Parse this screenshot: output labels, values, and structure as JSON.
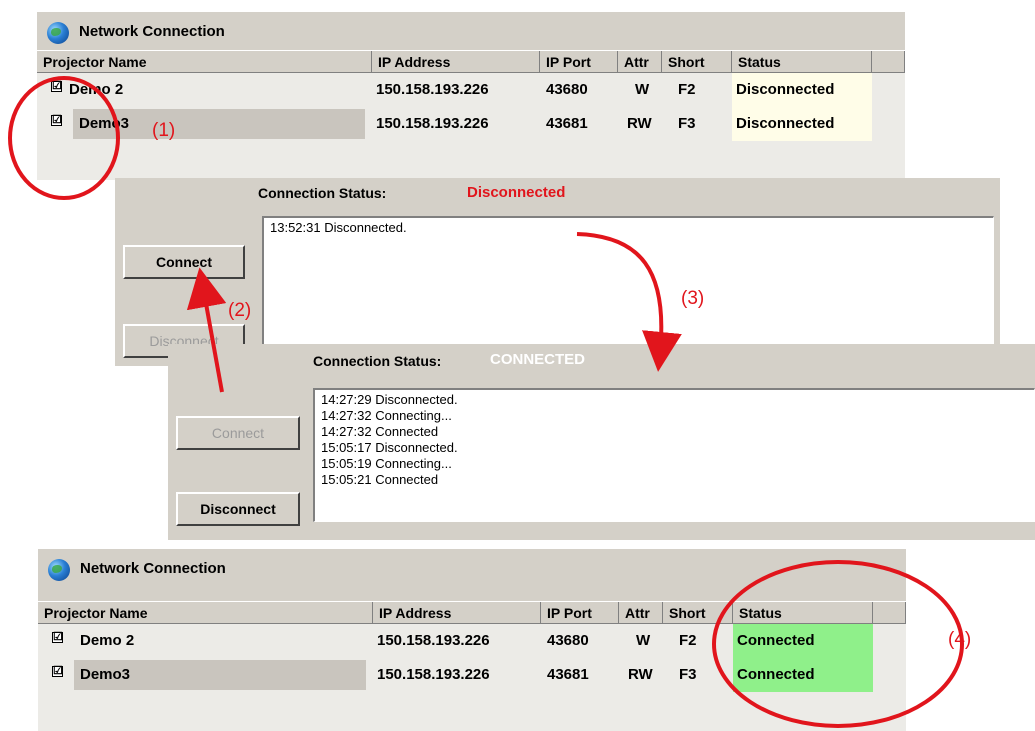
{
  "top_window": {
    "title": "Network Connection",
    "columns": [
      "Projector Name",
      "IP Address",
      "IP Port",
      "Attr",
      "Short",
      "Status"
    ],
    "rows": [
      {
        "checked": "☑",
        "name": "Demo 2",
        "ip": "150.158.193.226",
        "port": "43680",
        "attr": "W",
        "short": "F2",
        "status": "Disconnected"
      },
      {
        "checked": "☑",
        "name": "Demo3",
        "ip": "150.158.193.226",
        "port": "43681",
        "attr": "RW",
        "short": "F3",
        "status": "Disconnected"
      }
    ]
  },
  "panel_disconnected": {
    "status_label": "Connection Status:",
    "status_value": "Disconnected",
    "status_color": "#e1151c",
    "connect_label": "Connect",
    "disconnect_label": "Disconnect",
    "log": [
      "13:52:31 Disconnected."
    ]
  },
  "panel_connected": {
    "status_label": "Connection Status:",
    "status_value": "CONNECTED",
    "status_color": "#ffffff",
    "connect_label": "Connect",
    "disconnect_label": "Disconnect",
    "log": [
      "14:27:29 Disconnected.",
      "14:27:32 Connecting...",
      "14:27:32 Connected",
      "15:05:17 Disconnected.",
      "15:05:19 Connecting...",
      "15:05:21 Connected"
    ]
  },
  "bottom_window": {
    "title": "Network Connection",
    "columns": [
      "Projector Name",
      "IP Address",
      "IP Port",
      "Attr",
      "Short",
      "Status"
    ],
    "rows": [
      {
        "checked": "☑",
        "name": "Demo 2",
        "ip": "150.158.193.226",
        "port": "43680",
        "attr": "W",
        "short": "F2",
        "status": "Connected"
      },
      {
        "checked": "☑",
        "name": "Demo3",
        "ip": "150.158.193.226",
        "port": "43681",
        "attr": "RW",
        "short": "F3",
        "status": "Connected"
      }
    ]
  },
  "annotations": {
    "step1": "(1)",
    "step2": "(2)",
    "step3": "(3)",
    "step4": "(4)",
    "color": "#e1151c"
  }
}
